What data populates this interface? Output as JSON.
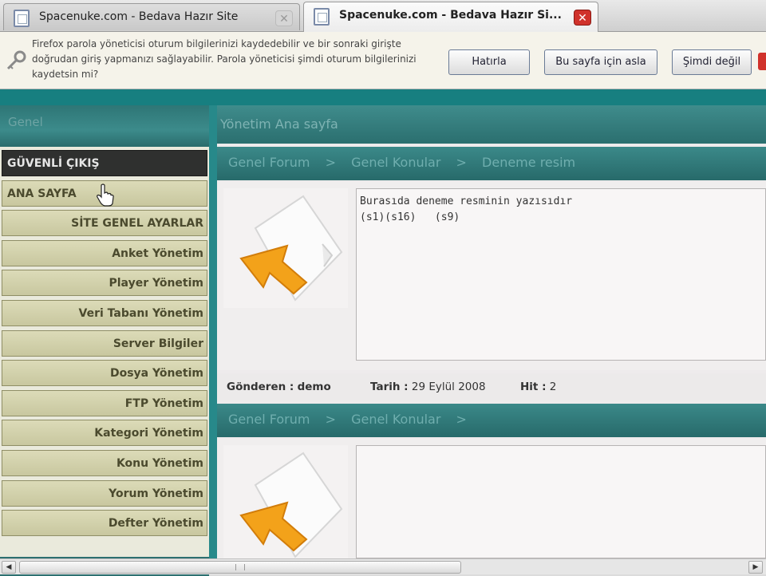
{
  "tabs": [
    {
      "title": "Spacenuke.com - Bedava Hazır Site"
    },
    {
      "title": "Spacenuke.com - Bedava Hazır Si..."
    }
  ],
  "notification": {
    "message": "Firefox parola yöneticisi oturum bilgilerinizi kaydedebilir ve bir sonraki girişte doğrudan giriş yapmanızı sağlayabilir. Parola yöneticisi şimdi oturum bilgilerinizi kaydetsin mi?",
    "buttons": [
      "Hatırla",
      "Bu sayfa için asla",
      "Şimdi değil"
    ]
  },
  "sidebar": {
    "header": "Genel",
    "items": [
      {
        "label": "GÜVENLİ ÇIKIŞ"
      },
      {
        "label": "ANA SAYFA"
      },
      {
        "label": "SİTE GENEL AYARLAR"
      },
      {
        "label": "Anket Yönetim"
      },
      {
        "label": "Player Yönetim"
      },
      {
        "label": "Veri Tabanı Yönetim"
      },
      {
        "label": "Server Bilgiler"
      },
      {
        "label": "Dosya Yönetim"
      },
      {
        "label": "FTP Yönetim"
      },
      {
        "label": "Kategori Yönetim"
      },
      {
        "label": "Konu Yönetim"
      },
      {
        "label": "Yorum Yönetim"
      },
      {
        "label": "Defter Yönetim"
      }
    ]
  },
  "content": {
    "title": "Yönetim Ana sayfa",
    "posts": [
      {
        "breadcrumb": [
          "Genel Forum",
          "Genel Konular",
          "Deneme resim"
        ],
        "separator": ">",
        "text_line1": "Burasıda deneme resminin yazısıdır",
        "text_line2": "(s1)(s16)   (s9)",
        "sender_label": "Gönderen :",
        "sender": "demo",
        "date_label": "Tarih :",
        "date": "29 Eylül 2008",
        "hit_label": "Hit :",
        "hit": "2"
      },
      {
        "breadcrumb": [
          "Genel Forum",
          "Genel Konular"
        ],
        "separator": ">",
        "trailing_separator": ">"
      }
    ]
  },
  "colors": {
    "teal": "#1d8686",
    "sidebar_item": "#d2d1ab",
    "dark_item": "#2f302f"
  }
}
